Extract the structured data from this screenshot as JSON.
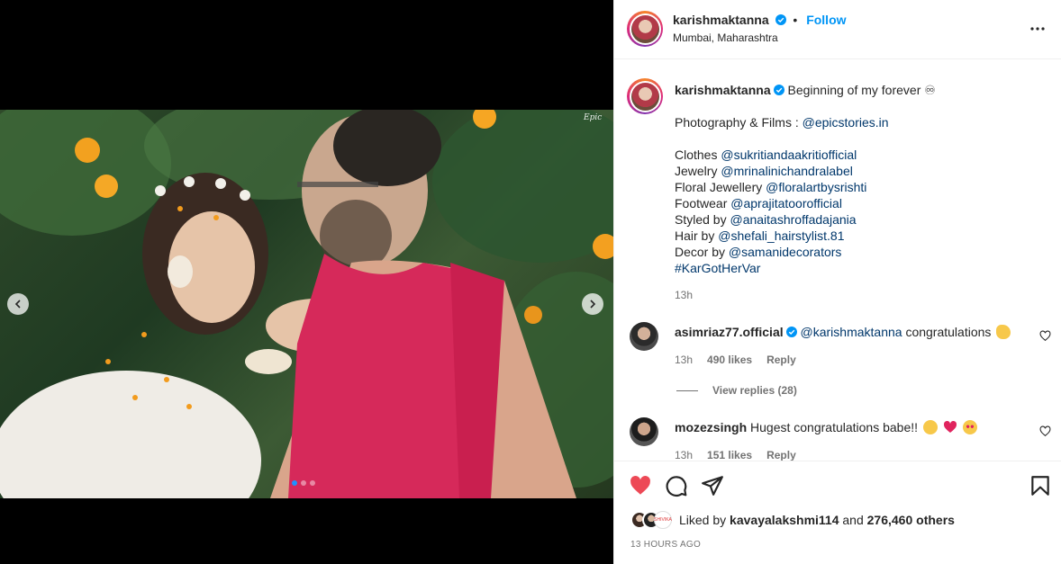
{
  "post": {
    "username": "karishmaktanna",
    "follow_label": "Follow",
    "bullet": "•",
    "location": "Mumbai, Maharashtra"
  },
  "media": {
    "watermark": "Epic",
    "slide_count": 3,
    "active_slide": 1
  },
  "caption": {
    "username": "karishmaktanna",
    "title": "Beginning of my forever ♾",
    "photo_label": "Photography & Films : ",
    "photo_mention": "@epicstories.in",
    "credits": [
      {
        "label": "Clothes ",
        "mention": "@sukritiandaakritiofficial"
      },
      {
        "label": "Jewelry ",
        "mention": "@mrinalinichandralabel"
      },
      {
        "label": "Floral Jewellery ",
        "mention": "@floralartbysrishti"
      },
      {
        "label": "Footwear ",
        "mention": "@aprajitatoorofficial"
      },
      {
        "label": "Styled by ",
        "mention": "@anaitashroffadajania"
      },
      {
        "label": "Hair by ",
        "mention": "@shefali_hairstylist.81"
      },
      {
        "label": "Decor by ",
        "mention": "@samanidecorators"
      }
    ],
    "hashtag": "#KarGotHerVar",
    "time": "13h"
  },
  "comments": [
    {
      "username": "asimriaz77.official",
      "mention": "@karishmaktanna",
      "text": " congratulations",
      "time": "13h",
      "likes": "490 likes",
      "reply": "Reply",
      "view_replies": "View replies (28)"
    },
    {
      "username": "mozezsingh",
      "text": "Hugest congratulations babe!!",
      "time": "13h",
      "likes": "151 likes",
      "reply": "Reply"
    }
  ],
  "footer": {
    "liked_by_prefix": "Liked by ",
    "liked_by_user": "kavayalakshmi114",
    "liked_by_and": " and ",
    "liked_by_count": "276,460 others",
    "liker_badge": "SHIVIKA",
    "posted_ago": "13 HOURS AGO"
  },
  "colors": {
    "accent_blue": "#0095f6",
    "like_red": "#ed4956",
    "mention": "#00376b",
    "muted": "#737373"
  }
}
